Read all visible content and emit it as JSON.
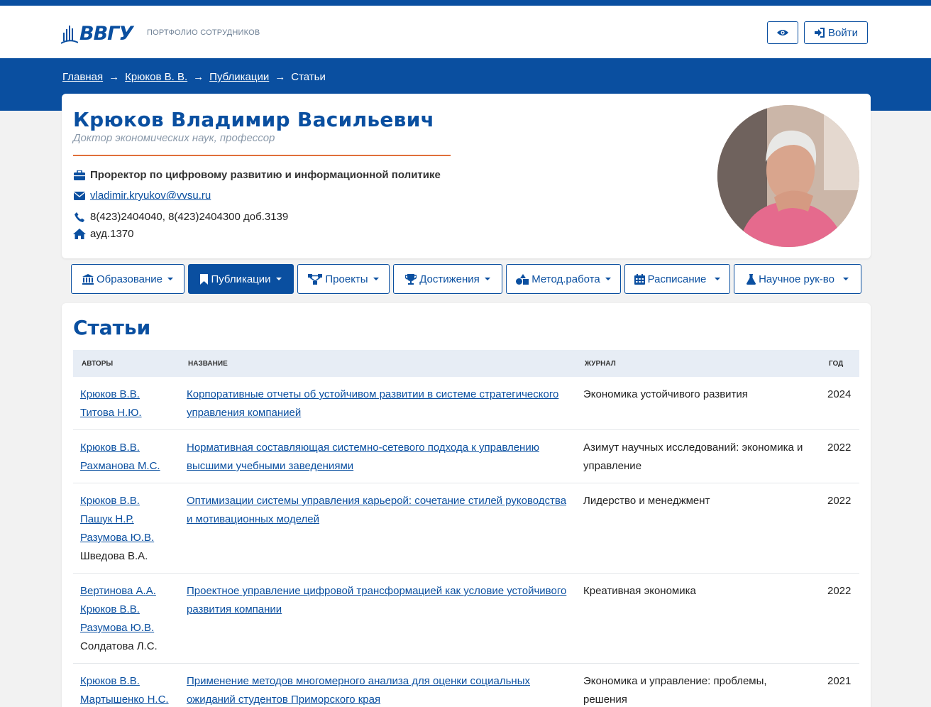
{
  "header": {
    "logo_text": "ВВГУ",
    "subtitle": "ПОРТФОЛИО СОТРУДНИКОВ",
    "login_label": "Войти"
  },
  "breadcrumb": [
    {
      "label": "Главная",
      "link": true
    },
    {
      "label": "Крюков В. В.",
      "link": true
    },
    {
      "label": "Публикации",
      "link": true
    },
    {
      "label": "Статьи",
      "link": false
    }
  ],
  "breadcrumb_sep": "→",
  "profile": {
    "name": "Крюков Владимир Васильевич",
    "degree": "Доктор экономических наук, профессор",
    "position": "Проректор по цифровому развитию и информационной политике",
    "email": "vladimir.kryukov@vvsu.ru",
    "phone": "8(423)2404040, 8(423)2404300 доб.3139",
    "room": "ауд.1370"
  },
  "tabs": [
    {
      "label": "Образование",
      "icon": "university-icon"
    },
    {
      "label": "Публикации",
      "icon": "bookmark-icon"
    },
    {
      "label": "Проекты",
      "icon": "sitemap-icon"
    },
    {
      "label": "Достижения",
      "icon": "trophy-icon"
    },
    {
      "label": "Метод.работа",
      "icon": "shapes-icon"
    },
    {
      "label": "Расписание",
      "icon": "calendar-icon"
    },
    {
      "label": "Научное рук-во",
      "icon": "flask-icon"
    }
  ],
  "section": {
    "title": "Статьи",
    "columns": [
      "АВТОРЫ",
      "НАЗВАНИЕ",
      "ЖУРНАЛ",
      "ГОД"
    ],
    "rows": [
      {
        "authors": [
          "Крюков В.В.",
          "Титова Н.Ю."
        ],
        "title": "Корпоративные отчеты об устойчивом развитии в системе стратегического управления компанией",
        "journal": "Экономика устойчивого развития",
        "year": "2024"
      },
      {
        "authors": [
          "Крюков В.В.",
          "Рахманова М.С."
        ],
        "title": "Нормативная составляющая системно-сетевого подхода к управлению высшими учебными заведениями",
        "journal": "Азимут научных исследований: экономика и управление",
        "year": "2022"
      },
      {
        "authors": [
          "Крюков В.В.",
          "Пашук Н.Р.",
          "Разумова Ю.В.",
          "Шведова В.А."
        ],
        "title": "Оптимизации системы управления карьерой: сочетание стилей руководства и мотивационных моделей",
        "journal": "Лидерство и менеджмент",
        "year": "2022"
      },
      {
        "authors": [
          "Вертинова А.А.",
          "Крюков В.В.",
          "Разумова Ю.В.",
          "Солдатова Л.С."
        ],
        "title": "Проектное управление цифровой трансформацией как условие устойчивого развития компании",
        "journal": "Креативная экономика",
        "year": "2022"
      },
      {
        "authors": [
          "Крюков В.В.",
          "Мартышенко Н.С."
        ],
        "title": "Применение методов многомерного анализа для оценки социальных ожиданий студентов Приморского края",
        "journal": "Экономика и управление: проблемы, решения",
        "year": "2021"
      }
    ],
    "plain_authors": [
      "Шведова В.А.",
      "Солдатова Л.С."
    ]
  },
  "colors": {
    "brand": "#0a4fa0",
    "accent_line": "#e0703a"
  }
}
